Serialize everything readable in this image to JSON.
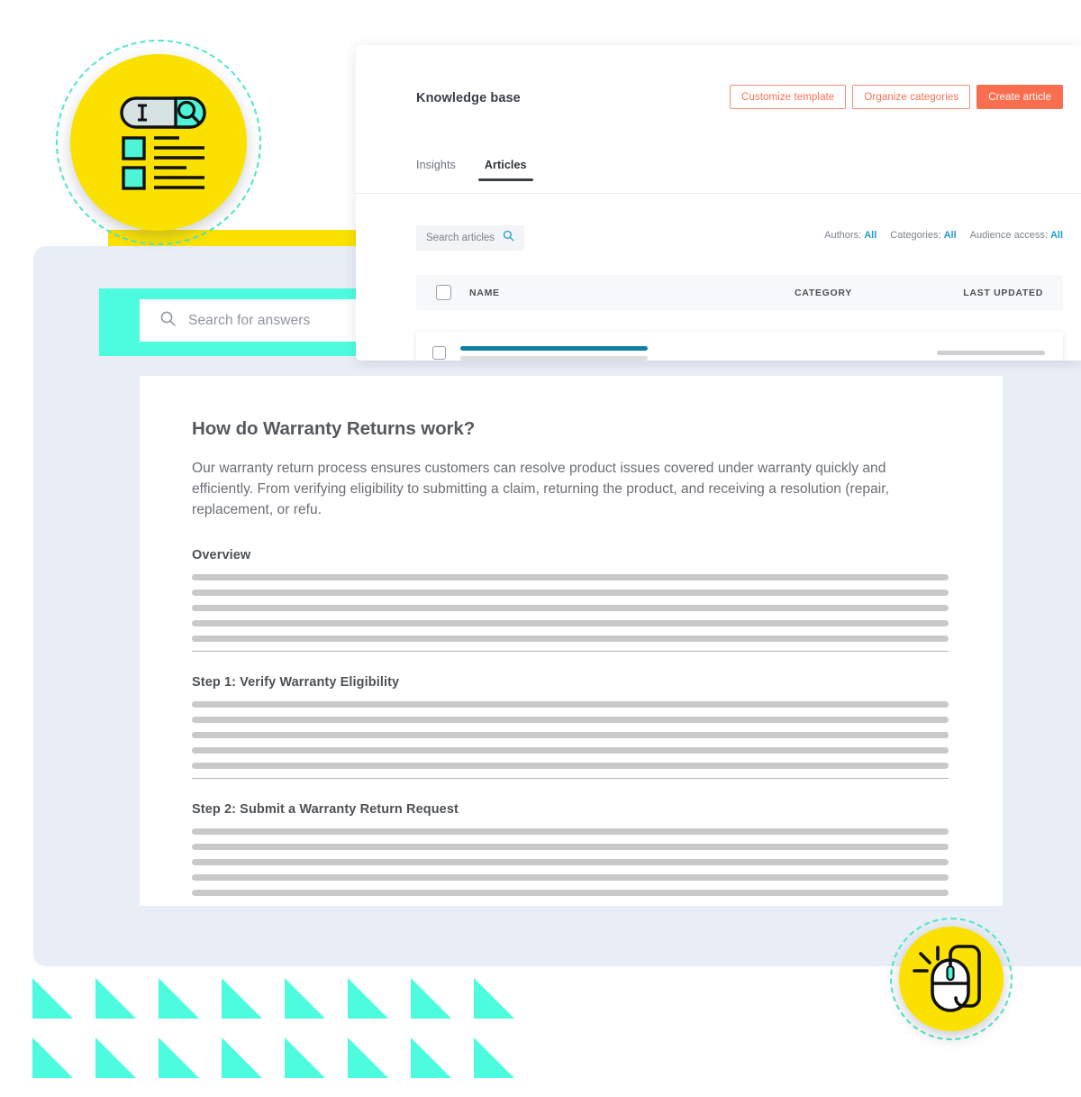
{
  "knowledge_base": {
    "title": "Knowledge base",
    "actions": [
      {
        "label": "Customize template",
        "style": "outline"
      },
      {
        "label": "Organize categories",
        "style": "outline"
      },
      {
        "label": "Create article",
        "style": "solid"
      }
    ],
    "tabs": [
      {
        "label": "Insights",
        "active": false
      },
      {
        "label": "Articles",
        "active": true
      }
    ],
    "search": {
      "placeholder": "Search articles",
      "icon": "search-icon"
    },
    "filters": [
      {
        "label": "Authors:",
        "value": "All"
      },
      {
        "label": "Categories:",
        "value": "All"
      },
      {
        "label": "Audience access:",
        "value": "All"
      }
    ],
    "table": {
      "columns": [
        "NAME",
        "CATEGORY",
        "LAST UPDATED"
      ],
      "rows": [
        {
          "name_placeholder": true,
          "category": "",
          "last_updated_placeholder": true
        }
      ]
    },
    "accent_colors": {
      "action": "#FA6E50",
      "link": "#1F9BD1",
      "row_title": "#0D80A3"
    }
  },
  "help_center": {
    "search": {
      "placeholder": "Search for answers",
      "icon": "search-icon"
    },
    "band_color": "#4DFBDE"
  },
  "article": {
    "title": "How do Warranty Returns work?",
    "intro": "Our warranty return process ensures customers can resolve product issues covered under warranty quickly and efficiently. From verifying eligibility to submitting a claim, returning the product, and receiving a resolution (repair, replacement, or refu.",
    "sections": [
      {
        "heading": "Overview",
        "placeholder_lines": 5,
        "divider_above": false
      },
      {
        "heading": "Step 1: Verify Warranty Eligibility",
        "placeholder_lines": 5,
        "divider_above": true
      },
      {
        "heading": "Step 2: Submit a Warranty Return Request",
        "placeholder_lines": 5,
        "divider_above": true
      }
    ]
  },
  "decorations": {
    "badge_knowledge_base": {
      "icon": "search-list-icon",
      "circle_color": "#FAE100",
      "ring_color": "#4DE8C8"
    },
    "badge_mouse": {
      "icon": "computer-mouse-icon",
      "circle_color": "#FAE100",
      "ring_color": "#4DE8C8"
    },
    "triangles": {
      "rows": 2,
      "per_row": 8,
      "color": "#4DFBDE"
    },
    "panel_color": "#E9EDF5",
    "yellow_bar_color": "#FAE100"
  }
}
